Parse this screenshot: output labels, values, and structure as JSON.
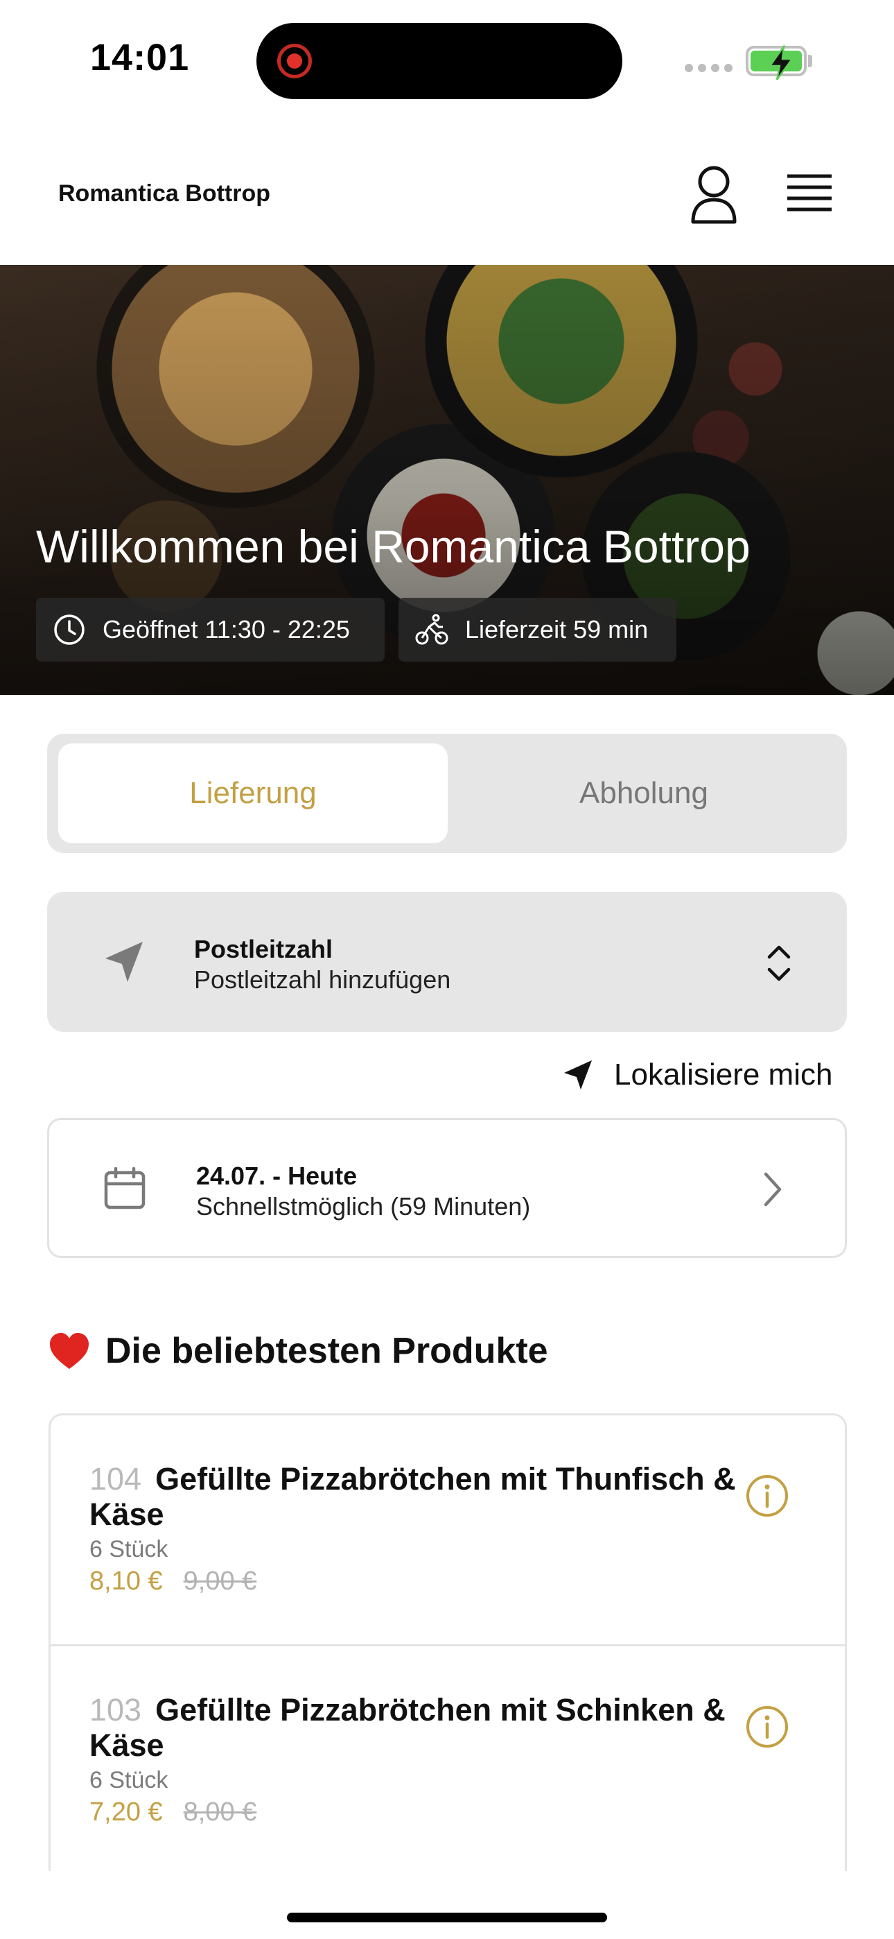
{
  "status_bar": {
    "time": "14:01",
    "battery_color": "#5ccf55",
    "recording_color": "#e0312a"
  },
  "header": {
    "restaurant_name": "Romantica Bottrop",
    "profile_icon": "person-icon",
    "menu_icon": "hamburger-menu-icon"
  },
  "hero": {
    "title": "Willkommen bei Romantica Bottrop",
    "opening_hours": "Geöffnet 11:30 - 22:25",
    "delivery_time": "Lieferzeit 59 min"
  },
  "order_mode": {
    "options": [
      "Lieferung",
      "Abholung"
    ],
    "selected": "Lieferung",
    "accent_color": "#c3a043"
  },
  "postcode": {
    "label": "Postleitzahl",
    "placeholder": "Postleitzahl hinzufügen"
  },
  "locate": {
    "label": "Lokalisiere mich"
  },
  "schedule": {
    "date": "24.07. - Heute",
    "time": "Schnellstmöglich (59 Minuten)"
  },
  "popular": {
    "emoji": "❤️",
    "title": "Die beliebtesten Produkte",
    "products": [
      {
        "number": "104",
        "name": "Gefüllte Pizzabrötchen mit Thunfisch & Käse",
        "description": "6 Stück",
        "price": "8,10 €",
        "old_price": "9,00 €"
      },
      {
        "number": "103",
        "name": "Gefüllte Pizzabrötchen mit Schinken & Käse",
        "description": "6 Stück",
        "price": "7,20 €",
        "old_price": "8,00 €"
      }
    ]
  }
}
